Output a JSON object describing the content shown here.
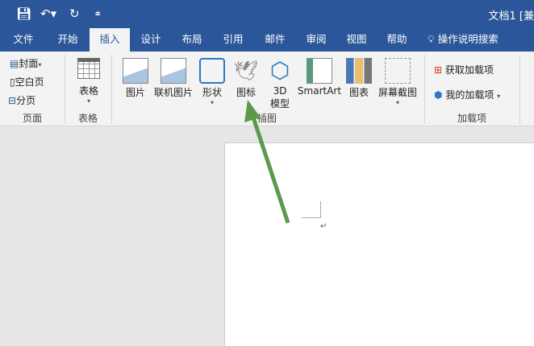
{
  "titlebar": {
    "title": "文档1 [兼",
    "icons": [
      "save-icon",
      "undo-icon",
      "redo-icon",
      "customize-icon"
    ]
  },
  "tabs": [
    "文件",
    "开始",
    "插入",
    "设计",
    "布局",
    "引用",
    "邮件",
    "审阅",
    "视图",
    "帮助"
  ],
  "tell_me": "操作说明搜索",
  "ribbon": {
    "pages": {
      "cover": "封面",
      "blank": "空白页",
      "break": "分页",
      "label": "页面"
    },
    "tables": {
      "table": "表格",
      "label": "表格"
    },
    "illustrations": {
      "picture": "图片",
      "online_picture": "联机图片",
      "shapes": "形状",
      "icons": "图标",
      "model3d_1": "3D",
      "model3d_2": "模型",
      "smartart": "SmartArt",
      "chart": "图表",
      "screenshot": "屏幕截图",
      "label": "插图"
    },
    "addins": {
      "get": "获取加载项",
      "mine": "我的加载项",
      "label": "加载项"
    }
  },
  "document": {
    "paragraph_mark": "↵"
  },
  "colors": {
    "brand": "#2b579a",
    "arrow": "#5a9a4a"
  }
}
